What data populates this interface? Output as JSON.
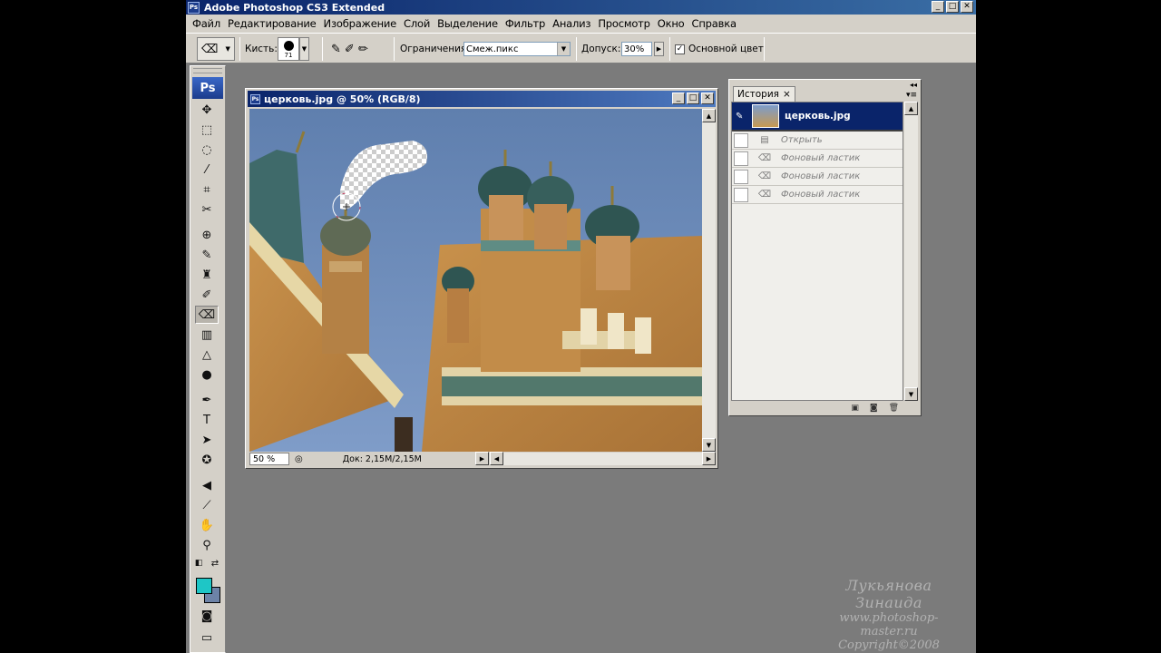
{
  "window": {
    "title": "Adobe Photoshop CS3 Extended",
    "logo": "Ps",
    "minimize": "_",
    "maximize": "□",
    "close": "✕"
  },
  "menu": [
    "Файл",
    "Редактирование",
    "Изображение",
    "Слой",
    "Выделение",
    "Фильтр",
    "Анализ",
    "Просмотр",
    "Окно",
    "Справка"
  ],
  "options": {
    "brush_label": "Кисть:",
    "brush_size": "71",
    "limits_label": "Ограничения:",
    "limits_value": "Смеж.пикс",
    "tolerance_label": "Допуск:",
    "tolerance_value": "30%",
    "protect_fg_label": "Основной цвет",
    "protect_fg_checked": "✓"
  },
  "toolbox": {
    "logo": "Ps",
    "foreground_color": "#1ec6c6",
    "background_color": "#6d83a7"
  },
  "document": {
    "title": "церковь.jpg @ 50% (RGB/8)",
    "zoom": "50 %",
    "info": "Док: 2,15M/2,15M"
  },
  "history": {
    "tab_label": "История",
    "tab_close": "×",
    "snapshot": "церковь.jpg",
    "items": [
      "Открыть",
      "Фоновый ластик",
      "Фоновый ластик",
      "Фоновый ластик"
    ]
  },
  "watermark": {
    "name": "Лукьянова Зинаида",
    "url": "www.photoshop-master.ru",
    "copyright": "Copyright©2008"
  }
}
